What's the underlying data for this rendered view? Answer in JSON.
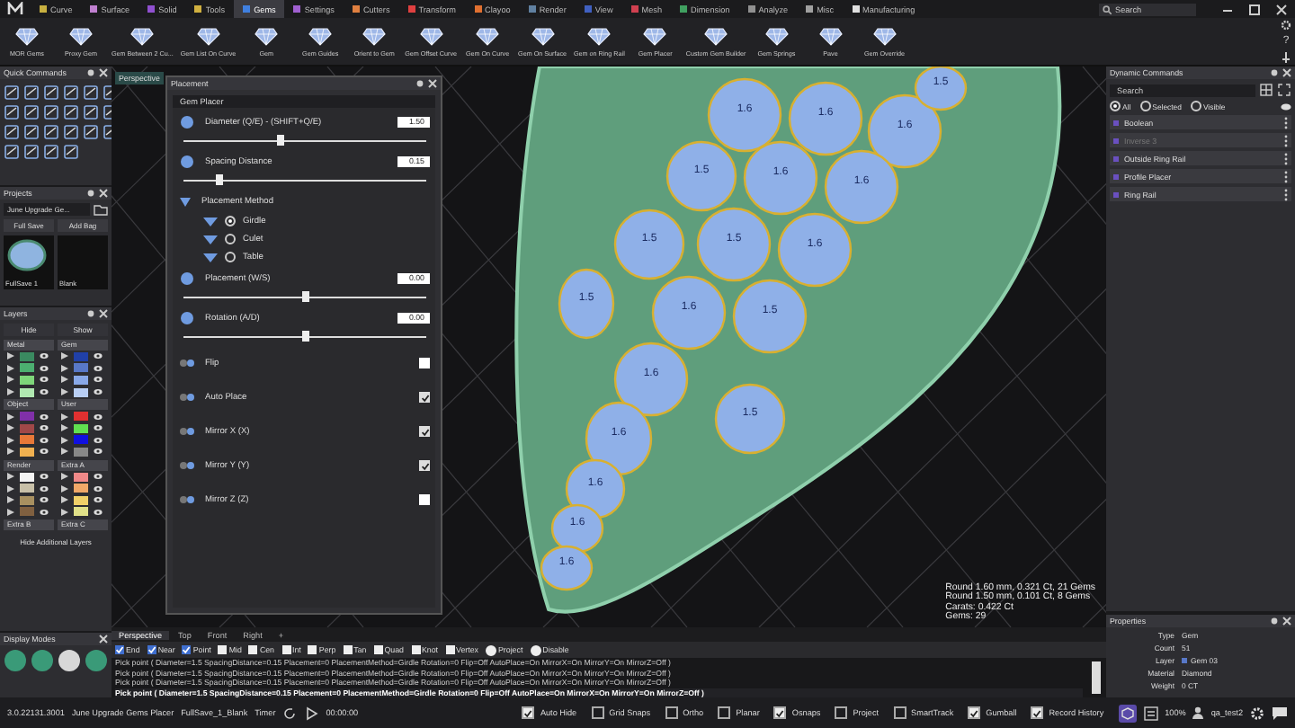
{
  "menu_tabs": [
    {
      "label": "Curve",
      "selected": false,
      "color": "#c8b040"
    },
    {
      "label": "Surface",
      "selected": false,
      "color": "#c080d0"
    },
    {
      "label": "Solid",
      "selected": false,
      "color": "#9050d0"
    },
    {
      "label": "Tools",
      "selected": false,
      "color": "#d0b040"
    },
    {
      "label": "Gems",
      "selected": true,
      "color": "#4080e0"
    },
    {
      "label": "Settings",
      "selected": false,
      "color": "#a060d0"
    },
    {
      "label": "Cutters",
      "selected": false,
      "color": "#e08040"
    },
    {
      "label": "Transform",
      "selected": false,
      "color": "#e04040"
    },
    {
      "label": "Clayoo",
      "selected": false,
      "color": "#e07030"
    },
    {
      "label": "Render",
      "selected": false,
      "color": "#6080a0"
    },
    {
      "label": "View",
      "selected": false,
      "color": "#4060c0"
    },
    {
      "label": "Mesh",
      "selected": false,
      "color": "#d04050"
    },
    {
      "label": "Dimension",
      "selected": false,
      "color": "#40a060"
    },
    {
      "label": "Analyze",
      "selected": false,
      "color": "#909090"
    },
    {
      "label": "Misc",
      "selected": false,
      "color": "#a0a0a0"
    },
    {
      "label": "Manufacturing",
      "selected": false,
      "color": "#e0e0e0"
    }
  ],
  "search": {
    "placeholder": "Search"
  },
  "toolbar": [
    "MOR Gems",
    "Proxy Gem",
    "Gem Between 2 Cu...",
    "Gem List On Curve",
    "Gem",
    "Gem Guides",
    "Orient to Gem",
    "Gem Offset Curve",
    "Gem On Curve",
    "Gem On Surface",
    "Gem on Ring Rail",
    "Gem Placer",
    "Custom Gem Builder",
    "Gem Springs",
    "Pave",
    "Gem Override"
  ],
  "toolbar_help": "?",
  "quick_commands": {
    "title": "Quick Commands"
  },
  "projects": {
    "title": "Projects",
    "dropdown": "June Upgrade Ge...",
    "buttons": [
      "Full Save",
      "Add Bag"
    ],
    "thumbnails": [
      {
        "label": "FullSave 1",
        "kind": "render"
      },
      {
        "label": "Blank",
        "kind": "blank"
      }
    ]
  },
  "layers": {
    "title": "Layers",
    "buttons": [
      "Hide",
      "Show"
    ],
    "groups": [
      {
        "name": "Metal",
        "swatches": [
          {
            "color": "#3a8a60"
          },
          {
            "color": "#4caf70"
          },
          {
            "color": "#7ed67a"
          },
          {
            "color": "#b0e8b0"
          }
        ]
      },
      {
        "name": "Gem",
        "swatches": [
          {
            "color": "#2040a8"
          },
          {
            "color": "#5878c8"
          },
          {
            "color": "#88a8e8"
          },
          {
            "color": "#b8cef4"
          }
        ]
      },
      {
        "name": "Object",
        "swatches": [
          {
            "color": "#8030a8"
          },
          {
            "color": "#a04848"
          },
          {
            "color": "#e87838"
          },
          {
            "color": "#f0b050"
          }
        ]
      },
      {
        "name": "User",
        "swatches": [
          {
            "color": "#e03030"
          },
          {
            "color": "#60e050"
          },
          {
            "color": "#1010e0"
          },
          {
            "color": "#888888"
          }
        ]
      },
      {
        "name": "Render",
        "swatches": [
          {
            "color": "#f4f4f4"
          },
          {
            "color": "#c8c0a8"
          },
          {
            "color": "#a89060"
          },
          {
            "color": "#806040"
          }
        ]
      },
      {
        "name": "Extra A",
        "swatches": [
          {
            "color": "#f08888"
          },
          {
            "color": "#f0a868"
          },
          {
            "color": "#f0d068"
          },
          {
            "color": "#e0e088"
          }
        ]
      },
      {
        "name": "Extra B"
      },
      {
        "name": "Extra C"
      }
    ],
    "hide_additional": "Hide Additional Layers"
  },
  "display_modes": {
    "title": "Display Modes"
  },
  "viewport": {
    "label": "Perspective",
    "gems": [
      "1.6",
      "1.6",
      "1.6",
      "1.5",
      "1.5",
      "1.6",
      "1.6",
      "1.5",
      "1.5",
      "1.6",
      "1.5",
      "1.6",
      "1.5",
      "1.6",
      "1.5",
      "1.6",
      "1.6",
      "1.6",
      "1.6"
    ],
    "summary": [
      "Round 1.60 mm, 0.321 Ct, 21 Gems",
      "Round 1.50 mm, 0.101 Ct, 8 Gems",
      "Carats: 0.422 Ct",
      "Gems: 29"
    ]
  },
  "gem_placer": {
    "title": "Placement",
    "tab": "Gem Placer",
    "rows": [
      {
        "kind": "slider",
        "label": "Diameter (Q/E) - (SHIFT+Q/E)",
        "value": "1.50",
        "level": 0.4
      },
      {
        "kind": "slider",
        "label": "Spacing Distance",
        "value": "0.15",
        "level": 0.15
      },
      {
        "kind": "method",
        "label": "Placement Method",
        "options": [
          {
            "label": "Girdle",
            "selected": true
          },
          {
            "label": "Culet",
            "selected": false
          },
          {
            "label": "Table",
            "selected": false
          }
        ]
      },
      {
        "kind": "slider",
        "label": "Placement (W/S)",
        "value": "0.00",
        "level": 0.5
      },
      {
        "kind": "slider",
        "label": "Rotation (A/D)",
        "value": "0.00",
        "level": 0.5
      },
      {
        "kind": "check",
        "label": "Flip",
        "checked": false
      },
      {
        "kind": "check",
        "label": "Auto Place",
        "checked": true
      },
      {
        "kind": "check",
        "label": "Mirror X (X)",
        "checked": true
      },
      {
        "kind": "check",
        "label": "Mirror Y (Y)",
        "checked": true
      },
      {
        "kind": "check",
        "label": "Mirror Z (Z)",
        "checked": false
      }
    ]
  },
  "dynamic_commands": {
    "title": "Dynamic Commands",
    "search": {
      "placeholder": "Search"
    },
    "filters": [
      {
        "label": "All",
        "selected": true
      },
      {
        "label": "Selected",
        "selected": false
      },
      {
        "label": "Visible",
        "selected": false
      }
    ],
    "items": [
      {
        "label": "Boolean",
        "disabled": false
      },
      {
        "label": "Inverse 3",
        "disabled": true
      },
      {
        "label": "Outside Ring Rail",
        "disabled": false
      },
      {
        "label": "Profile Placer",
        "disabled": false
      },
      {
        "label": "Ring Rail",
        "disabled": false
      }
    ]
  },
  "properties": {
    "title": "Properties",
    "rows": [
      {
        "key": "Type",
        "value": "Gem"
      },
      {
        "key": "Count",
        "value": "51"
      },
      {
        "key": "Layer",
        "value": "Gem 03",
        "color": "#5878c8"
      },
      {
        "key": "Material",
        "value": "Diamond"
      },
      {
        "key": "Weight",
        "value": "0 CT"
      }
    ]
  },
  "view_tabs": [
    {
      "label": "Perspective",
      "selected": true
    },
    {
      "label": "Top",
      "selected": false
    },
    {
      "label": "Front",
      "selected": false
    },
    {
      "label": "Right",
      "selected": false
    },
    {
      "label": "+",
      "selected": false
    }
  ],
  "osnaps": [
    {
      "label": "End",
      "kind": "check",
      "checked": true
    },
    {
      "label": "Near",
      "kind": "check",
      "checked": true
    },
    {
      "label": "Point",
      "kind": "check",
      "checked": true
    },
    {
      "label": "Mid",
      "kind": "check",
      "checked": false
    },
    {
      "label": "Cen",
      "kind": "check",
      "checked": false
    },
    {
      "label": "Int",
      "kind": "check",
      "checked": false
    },
    {
      "label": "Perp",
      "kind": "check",
      "checked": false
    },
    {
      "label": "Tan",
      "kind": "check",
      "checked": false
    },
    {
      "label": "Quad",
      "kind": "check",
      "checked": false
    },
    {
      "label": "Knot",
      "kind": "check",
      "checked": false
    },
    {
      "label": "Vertex",
      "kind": "check",
      "checked": false
    },
    {
      "label": "Project",
      "kind": "radio",
      "checked": false
    },
    {
      "label": "Disable",
      "kind": "radio",
      "checked": false
    }
  ],
  "history": [
    {
      "text": "Pick point ( Diameter=1.5 SpacingDistance=0.15 Placement=0 PlacementMethod=Girdle Rotation=0 Flip=Off AutoPlace=On MirrorX=On MirrorY=On MirrorZ=Off )",
      "current": false
    },
    {
      "text": "Pick point ( Diameter=1.5 SpacingDistance=0.15 Placement=0 PlacementMethod=Girdle Rotation=0 Flip=Off AutoPlace=On MirrorX=On MirrorY=On MirrorZ=Off )",
      "current": false
    },
    {
      "text": "Pick point ( Diameter=1.5 SpacingDistance=0.15 Placement=0 PlacementMethod=Girdle Rotation=0 Flip=Off AutoPlace=On MirrorX=On MirrorY=On MirrorZ=Off )",
      "current": false
    },
    {
      "text": "Pick point ( Diameter=1.5 SpacingDistance=0.15 Placement=0 PlacementMethod=Girdle Rotation=0 Flip=Off AutoPlace=On MirrorX=On MirrorY=On MirrorZ=Off )",
      "current": true
    }
  ],
  "status": {
    "version": "3.0.22131.3001",
    "project": "June Upgrade Gems Placer",
    "file": "FullSave_1_Blank",
    "timer_label": "Timer",
    "time": "00:00:00",
    "toggles": [
      {
        "label": "Auto Hide",
        "checked": true
      },
      {
        "label": "Grid Snaps",
        "checked": false
      },
      {
        "label": "Ortho",
        "checked": false
      },
      {
        "label": "Planar",
        "checked": false
      },
      {
        "label": "Osnaps",
        "checked": true
      },
      {
        "label": "Project",
        "checked": false
      },
      {
        "label": "SmartTrack",
        "checked": false
      },
      {
        "label": "Gumball",
        "checked": true
      },
      {
        "label": "Record History",
        "checked": true
      }
    ],
    "zoom": "100%",
    "user": "qa_test2"
  }
}
